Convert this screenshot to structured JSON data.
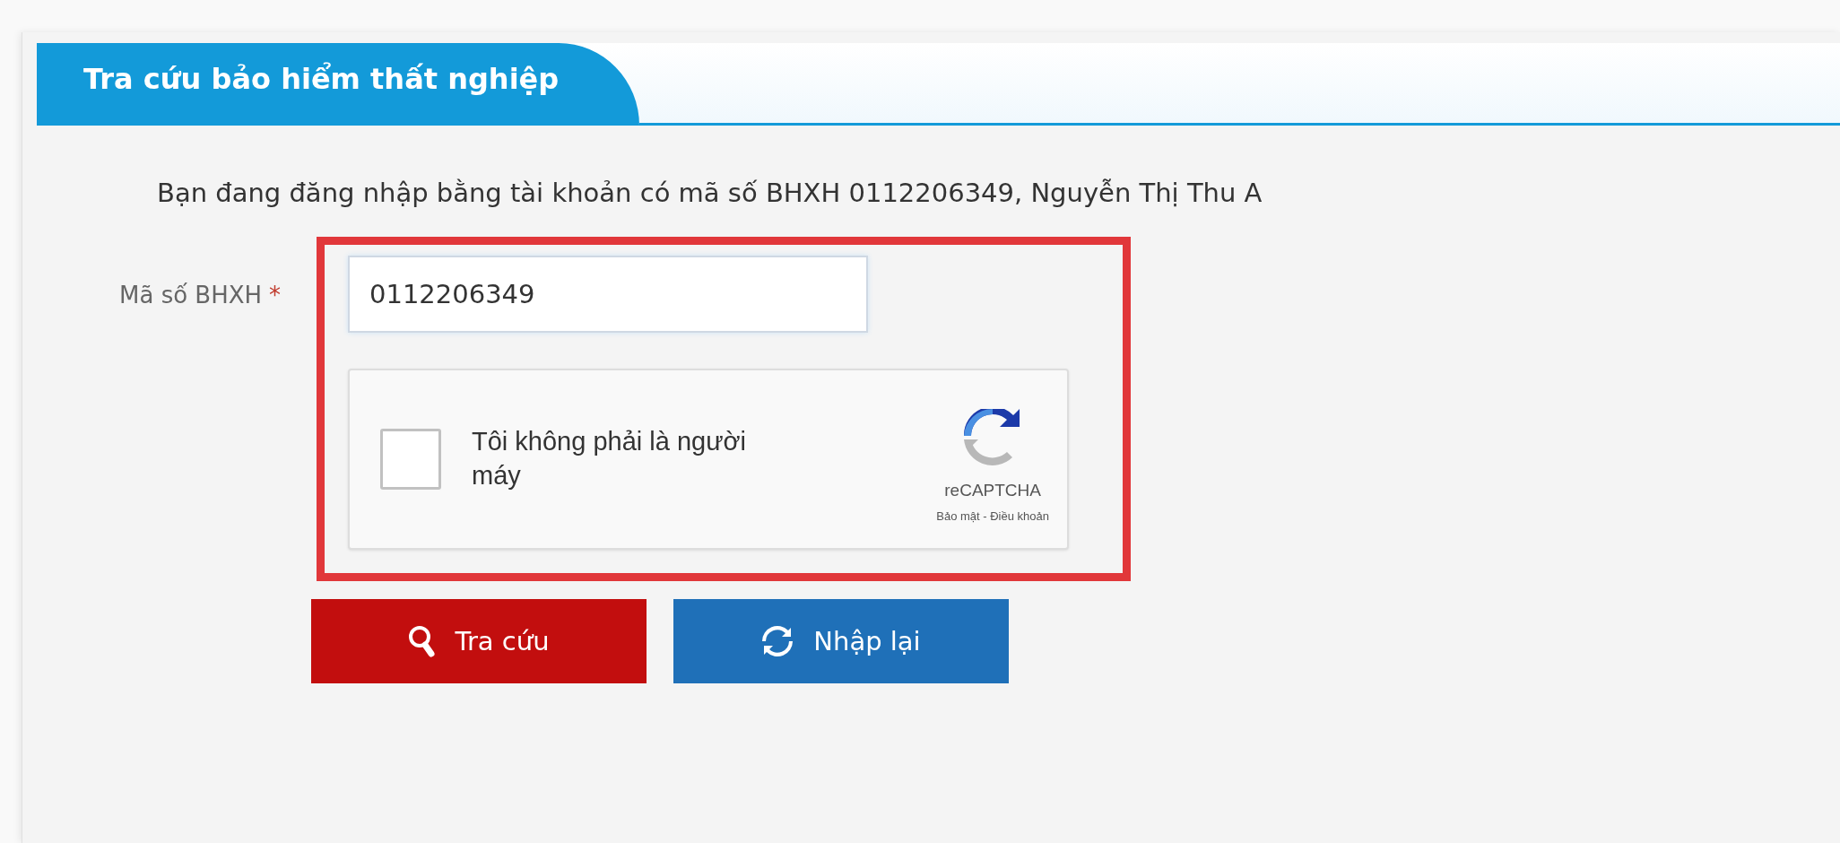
{
  "panel": {
    "title": "Tra cứu bảo hiểm thất nghiệp"
  },
  "info": "Bạn đang đăng nhập bằng tài khoản có mã số BHXH 0112206349, Nguyễn Thị Thu A",
  "form": {
    "label": "Mã số BHXH",
    "required_mark": "*",
    "value": "0112206349"
  },
  "captcha": {
    "checked": false,
    "label": "Tôi không phải là người máy",
    "brand": "reCAPTCHA",
    "links": "Bảo mật - Điều khoản"
  },
  "buttons": [
    {
      "label": "Tra cứu",
      "kind": "search"
    },
    {
      "label": "Nhập lại",
      "kind": "reset"
    }
  ]
}
